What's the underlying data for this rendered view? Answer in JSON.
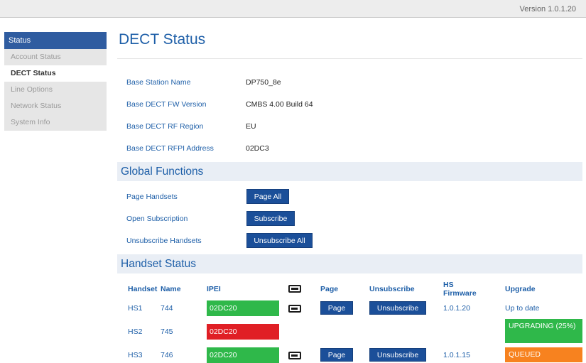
{
  "header": {
    "version": "Version 1.0.1.20"
  },
  "sidebar": {
    "heading": "Status",
    "items": [
      {
        "label": "Account Status",
        "active": false
      },
      {
        "label": "DECT Status",
        "active": true
      },
      {
        "label": "Line Options",
        "active": false
      },
      {
        "label": "Network Status",
        "active": false
      },
      {
        "label": "System Info",
        "active": false
      }
    ]
  },
  "page": {
    "title": "DECT Status"
  },
  "info": [
    {
      "label": "Base Station Name",
      "value": "DP750_8e"
    },
    {
      "label": "Base DECT FW Version",
      "value": "CMBS 4.00 Build 64"
    },
    {
      "label": "Base DECT RF Region",
      "value": "EU"
    },
    {
      "label": "Base DECT RFPI Address",
      "value": "02DC3"
    }
  ],
  "global": {
    "title": "Global Functions",
    "rows": [
      {
        "label": "Page Handsets",
        "button": "Page All"
      },
      {
        "label": "Open Subscription",
        "button": "Subscribe"
      },
      {
        "label": "Unsubscribe Handsets",
        "button": "Unsubscribe All"
      }
    ]
  },
  "handset_status": {
    "title": "Handset Status",
    "columns": {
      "handset": "Handset",
      "name": "Name",
      "ipei": "IPEI",
      "battery": "battery-icon",
      "page": "Page",
      "unsubscribe": "Unsubscribe",
      "firmware": "HS Firmware",
      "upgrade": "Upgrade"
    },
    "rows": [
      {
        "handset": "HS1",
        "name": "744",
        "ipei": "02DC20",
        "ipei_color": "#2fb84a",
        "battery": "battery-low-icon",
        "page": "Page",
        "unsubscribe": "Unsubscribe",
        "firmware": "1.0.1.20",
        "upgrade": "Up to date",
        "upgrade_color": ""
      },
      {
        "handset": "HS2",
        "name": "745",
        "ipei": "02DC20",
        "ipei_color": "#e01f25",
        "battery": "",
        "page": "",
        "unsubscribe": "",
        "firmware": "",
        "upgrade": "UPGRADING (25%)",
        "upgrade_color": "#2fb84a"
      },
      {
        "handset": "HS3",
        "name": "746",
        "ipei": "02DC20",
        "ipei_color": "#2fb84a",
        "battery": "battery-low-icon",
        "page": "Page",
        "unsubscribe": "Unsubscribe",
        "firmware": "1.0.1.15",
        "upgrade": "QUEUED",
        "upgrade_color": "#f7821f"
      }
    ]
  },
  "colors": {
    "accent": "#1e5fa8",
    "button": "#1b4f99",
    "sidebar_active_heading": "#2f5ca0"
  }
}
